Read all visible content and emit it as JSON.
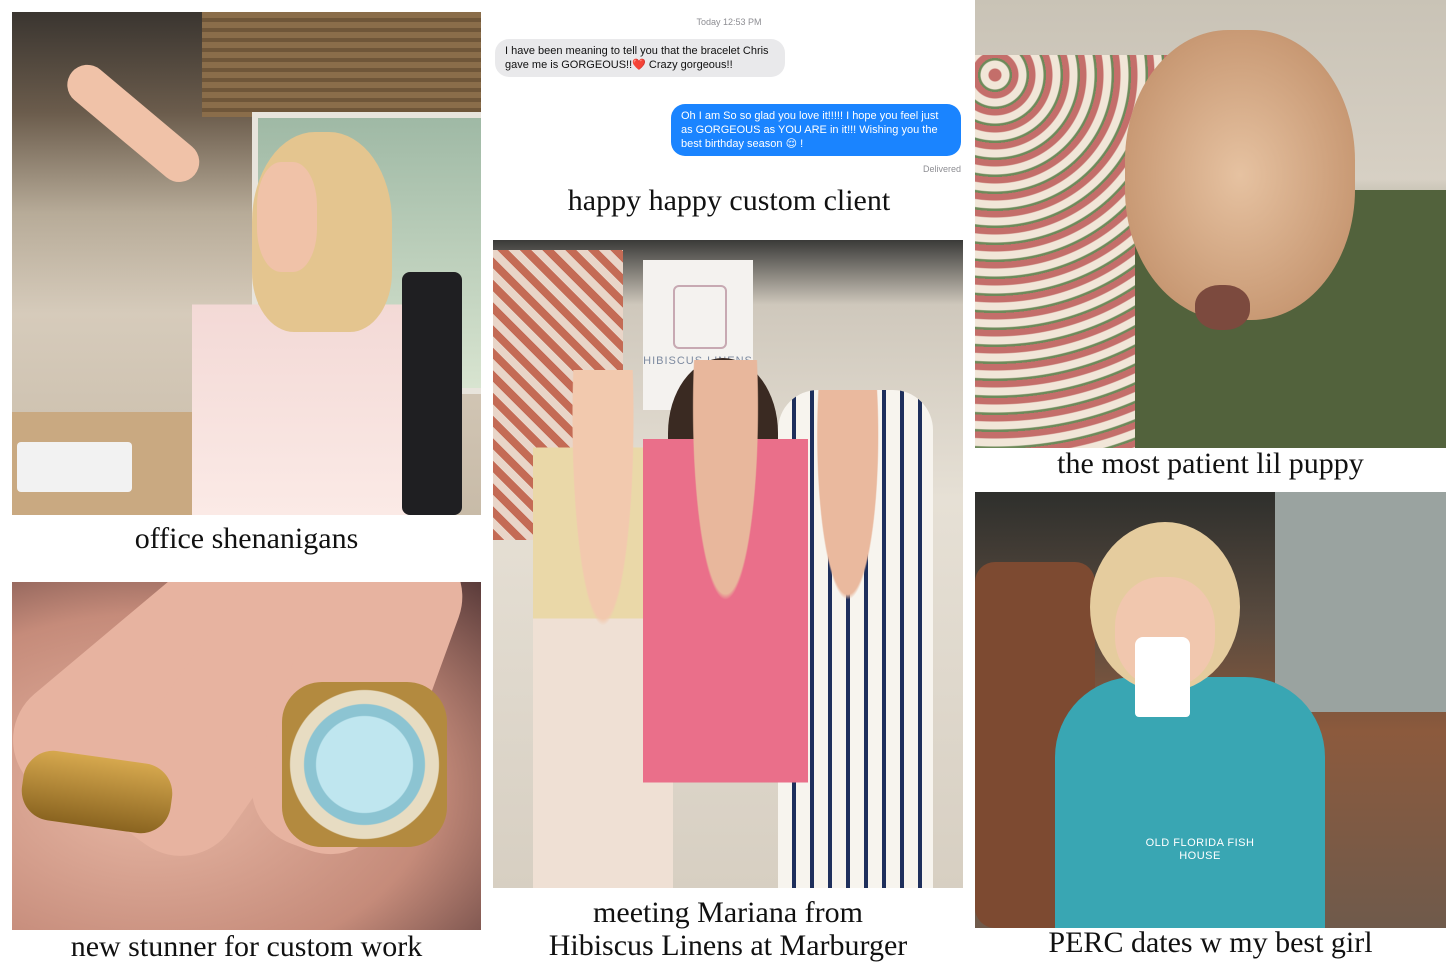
{
  "panels": {
    "office": {
      "caption": "office shenanigans"
    },
    "ring": {
      "caption": "new stunner for custom work"
    },
    "chat": {
      "timestamp": "Today 12:53 PM",
      "incoming_message": "I have been meaning to tell you that the bracelet Chris gave me is GORGEOUS!!❤️ Crazy gorgeous!!",
      "outgoing_message": "Oh I am So so glad you love it!!!!! I hope you feel just as GORGEOUS as YOU ARE in it!!! Wishing you the best birthday season 😌 !",
      "status": "Delivered",
      "caption": "happy happy custom client"
    },
    "group": {
      "banner_text": "HIBISCUS LINENS",
      "caption_line1": "meeting Mariana from",
      "caption_line2": "Hibiscus Linens at Marburger"
    },
    "puppy": {
      "caption": "the most patient lil puppy"
    },
    "girl": {
      "shirt_text": "OLD FLORIDA FISH HOUSE",
      "caption": "PERC dates w my best girl"
    }
  }
}
